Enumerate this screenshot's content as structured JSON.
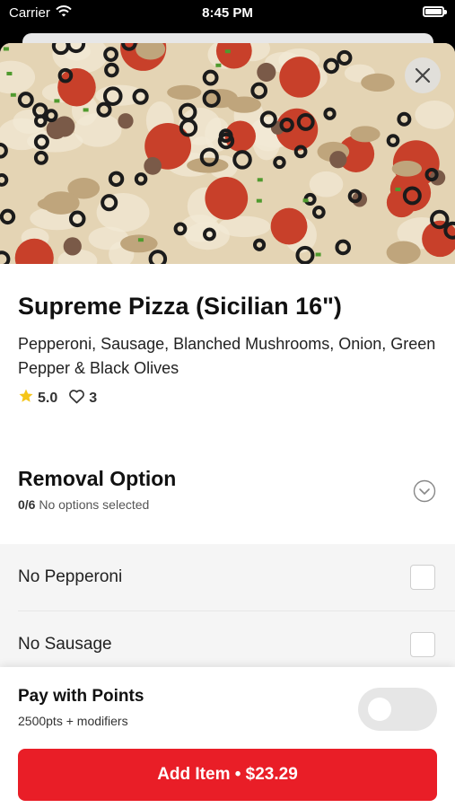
{
  "status_bar": {
    "carrier": "Carrier",
    "time": "8:45 PM",
    "battery_level": 1.0
  },
  "item": {
    "name": "Supreme Pizza (Sicilian 16\")",
    "description": "Pepperoni, Sausage, Blanched Mushrooms, Onion, Green Pepper & Black Olives",
    "rating": "5.0",
    "likes": "3"
  },
  "removal_option": {
    "title": "Removal Option",
    "count": "0/6",
    "status": "No options selected",
    "options": [
      {
        "label": "No Pepperoni",
        "checked": false
      },
      {
        "label": "No Sausage",
        "checked": false
      }
    ]
  },
  "pay_with_points": {
    "title": "Pay with Points",
    "subtitle": "2500pts + modifiers",
    "enabled": false
  },
  "add_button": {
    "label": "Add Item • $23.29"
  },
  "colors": {
    "accent": "#e91e27",
    "star": "#f5c518",
    "option_bg": "#f5f5f5",
    "toggle_off": "#e6e6e6"
  },
  "icons": [
    "wifi-icon",
    "battery-icon",
    "close-icon",
    "star-icon",
    "heart-icon",
    "chevron-down-icon"
  ]
}
